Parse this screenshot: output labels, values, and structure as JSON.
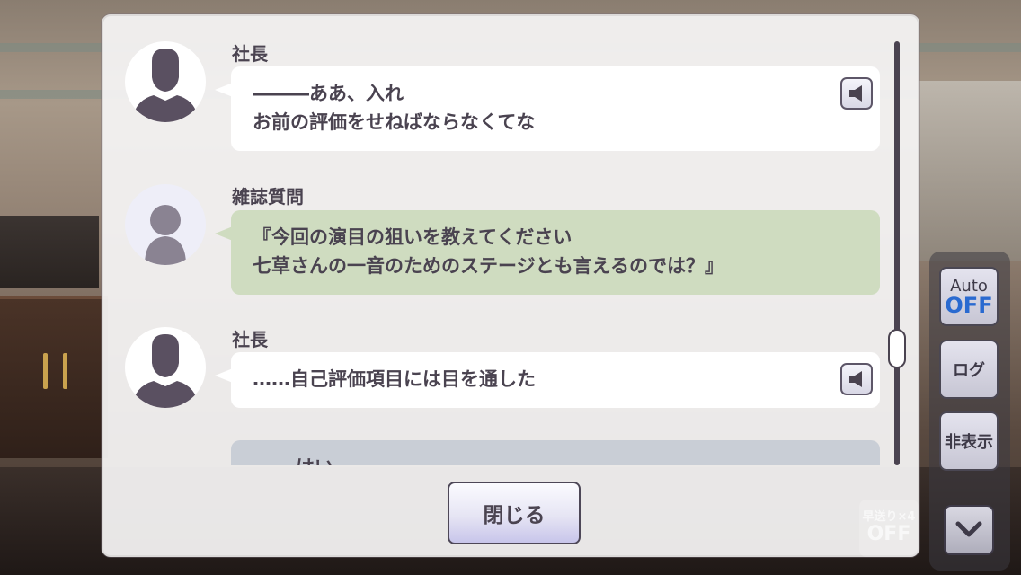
{
  "log": {
    "entries": [
      {
        "speaker": "社長",
        "lines": [
          "―――ああ、入れ",
          "お前の評価をせねばならなくてな"
        ],
        "style": "white",
        "voice": true
      },
      {
        "speaker": "雑誌質問",
        "lines": [
          "『今回の演目の狙いを教えてください",
          "七草さんの一音のためのステージとも言えるのでは？』"
        ],
        "style": "green",
        "voice": false
      },
      {
        "speaker": "社長",
        "lines": [
          "……自己評価項目には目を通した"
        ],
        "style": "white",
        "voice": true
      },
      {
        "speaker": "",
        "lines": [
          "はい"
        ],
        "style": "choice",
        "voice": false
      }
    ]
  },
  "close_label": "閉じる",
  "controls": {
    "auto_label": "Auto",
    "auto_state": "OFF",
    "log_label": "ログ",
    "hide_label": "非表示",
    "skip_label": "早送り×4",
    "skip_state": "OFF"
  },
  "colors": {
    "text": "#4a4350",
    "auto_state": "#2a6ad0",
    "green_bubble": "#cfdcc0",
    "choice_bubble": "#c9ced6"
  },
  "icons": [
    "speaker-icon",
    "chevron-down-icon",
    "silhouette-man-icon",
    "silhouette-person-icon"
  ]
}
